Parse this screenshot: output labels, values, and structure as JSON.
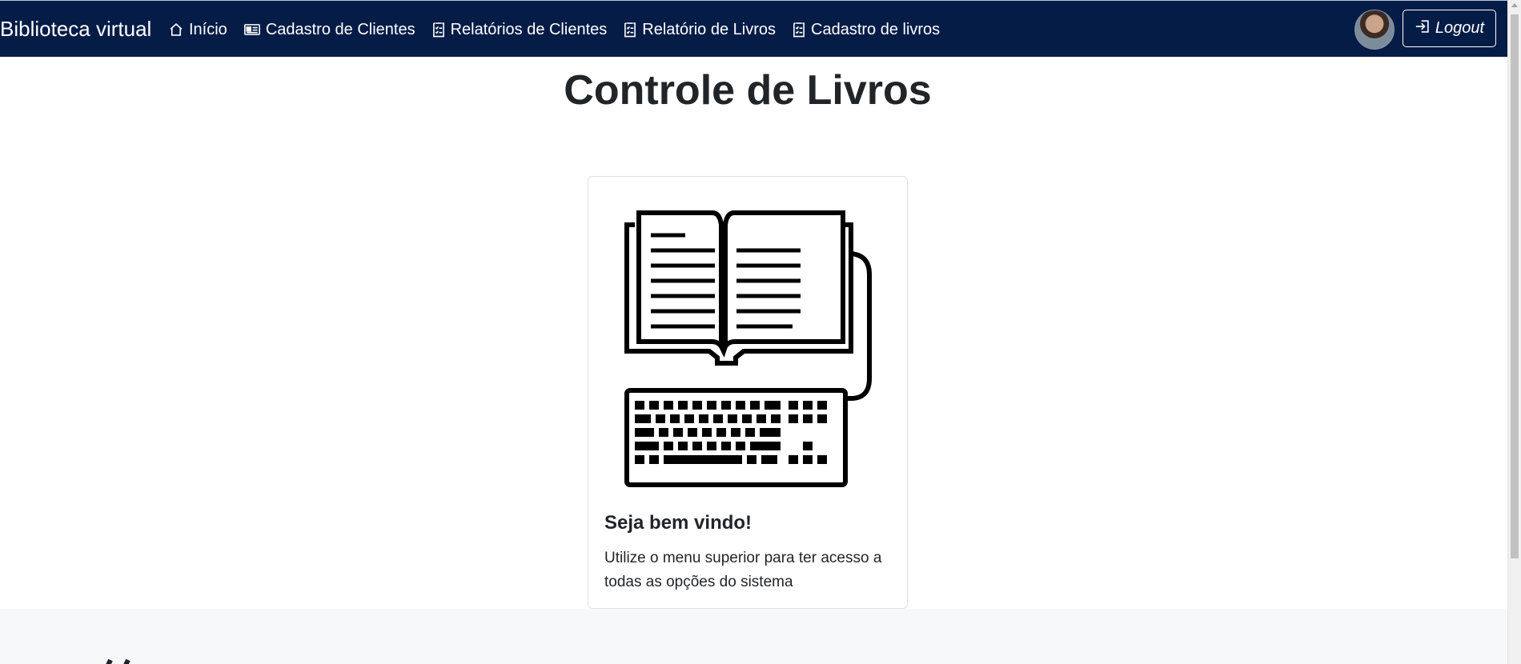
{
  "navbar": {
    "brand": "Biblioteca virtual",
    "items": [
      {
        "label": "Início",
        "icon": "house-icon"
      },
      {
        "label": "Cadastro de Clientes",
        "icon": "id-card-icon"
      },
      {
        "label": "Relatórios de Clientes",
        "icon": "checklist-icon"
      },
      {
        "label": "Relatório de Livros",
        "icon": "checklist-icon"
      },
      {
        "label": "Cadastro de livros",
        "icon": "checklist-icon"
      }
    ],
    "logout_label": "Logout",
    "avatar_icon": "user-avatar"
  },
  "main": {
    "title": "Controle de Livros",
    "card": {
      "image_icon": "book-keyboard-icon",
      "title": "Seja bem vindo!",
      "text": "Utilize o menu superior para ter acesso a todas as opções do sistema"
    }
  },
  "colors": {
    "navbar_bg": "#051c47",
    "footer_bg": "#f7f8fa"
  }
}
